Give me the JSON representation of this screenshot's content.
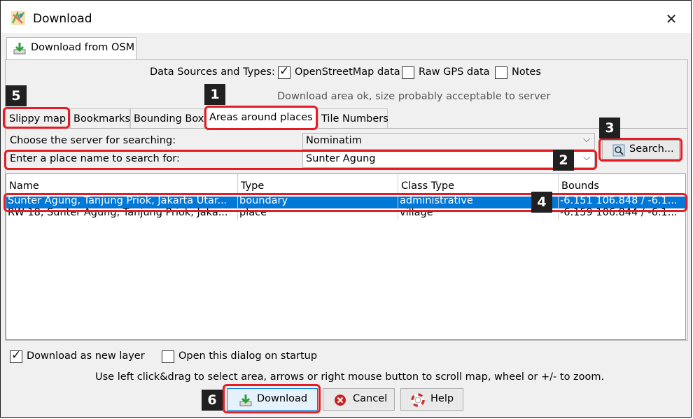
{
  "window": {
    "title": "Download"
  },
  "main_tab": {
    "label": "Download from OSM"
  },
  "sources": {
    "label": "Data Sources and Types:",
    "items": [
      {
        "label": "OpenStreetMap data",
        "checked": true
      },
      {
        "label": "Raw GPS data",
        "checked": false
      },
      {
        "label": "Notes",
        "checked": false
      }
    ],
    "status": "Download area ok, size probably acceptable to server"
  },
  "subtabs": [
    {
      "label": "Slippy map"
    },
    {
      "label": "Bookmarks"
    },
    {
      "label": "Bounding Box"
    },
    {
      "label": "Areas around places"
    },
    {
      "label": "Tile Numbers"
    }
  ],
  "search": {
    "server_label": "Choose the server for searching:",
    "server_value": "Nominatim",
    "place_label": "Enter a place name to search for:",
    "place_value": "Sunter Agung",
    "button_label": "Search..."
  },
  "table": {
    "columns": [
      "Name",
      "Type",
      "Class Type",
      "Bounds"
    ],
    "rows": [
      {
        "name": "Sunter Agung, Tanjung Priok, Jakarta Utar...",
        "type": "boundary",
        "class_type": "administrative",
        "bounds": "-6.151 106.848 / -6.1...",
        "selected": true
      },
      {
        "name": "RW 18, Sunter Agung, Tanjung Priok, Jaka...",
        "type": "place",
        "class_type": "village",
        "bounds": "-6.159 106.844 / -6.1...",
        "selected": false
      }
    ]
  },
  "options": {
    "new_layer": {
      "label": "Download as new layer",
      "checked": true
    },
    "startup": {
      "label": "Open this dialog on startup",
      "checked": false
    }
  },
  "hint": "Use left click&drag to select area, arrows or right mouse button to scroll map, wheel or +/- to zoom.",
  "buttons": {
    "download": "Download",
    "cancel": "Cancel",
    "help": "Help"
  },
  "badges": [
    "1",
    "2",
    "3",
    "4",
    "5",
    "6"
  ],
  "colors": {
    "highlight": "#e51c23",
    "selection": "#0078d7",
    "badge": "#202020"
  }
}
